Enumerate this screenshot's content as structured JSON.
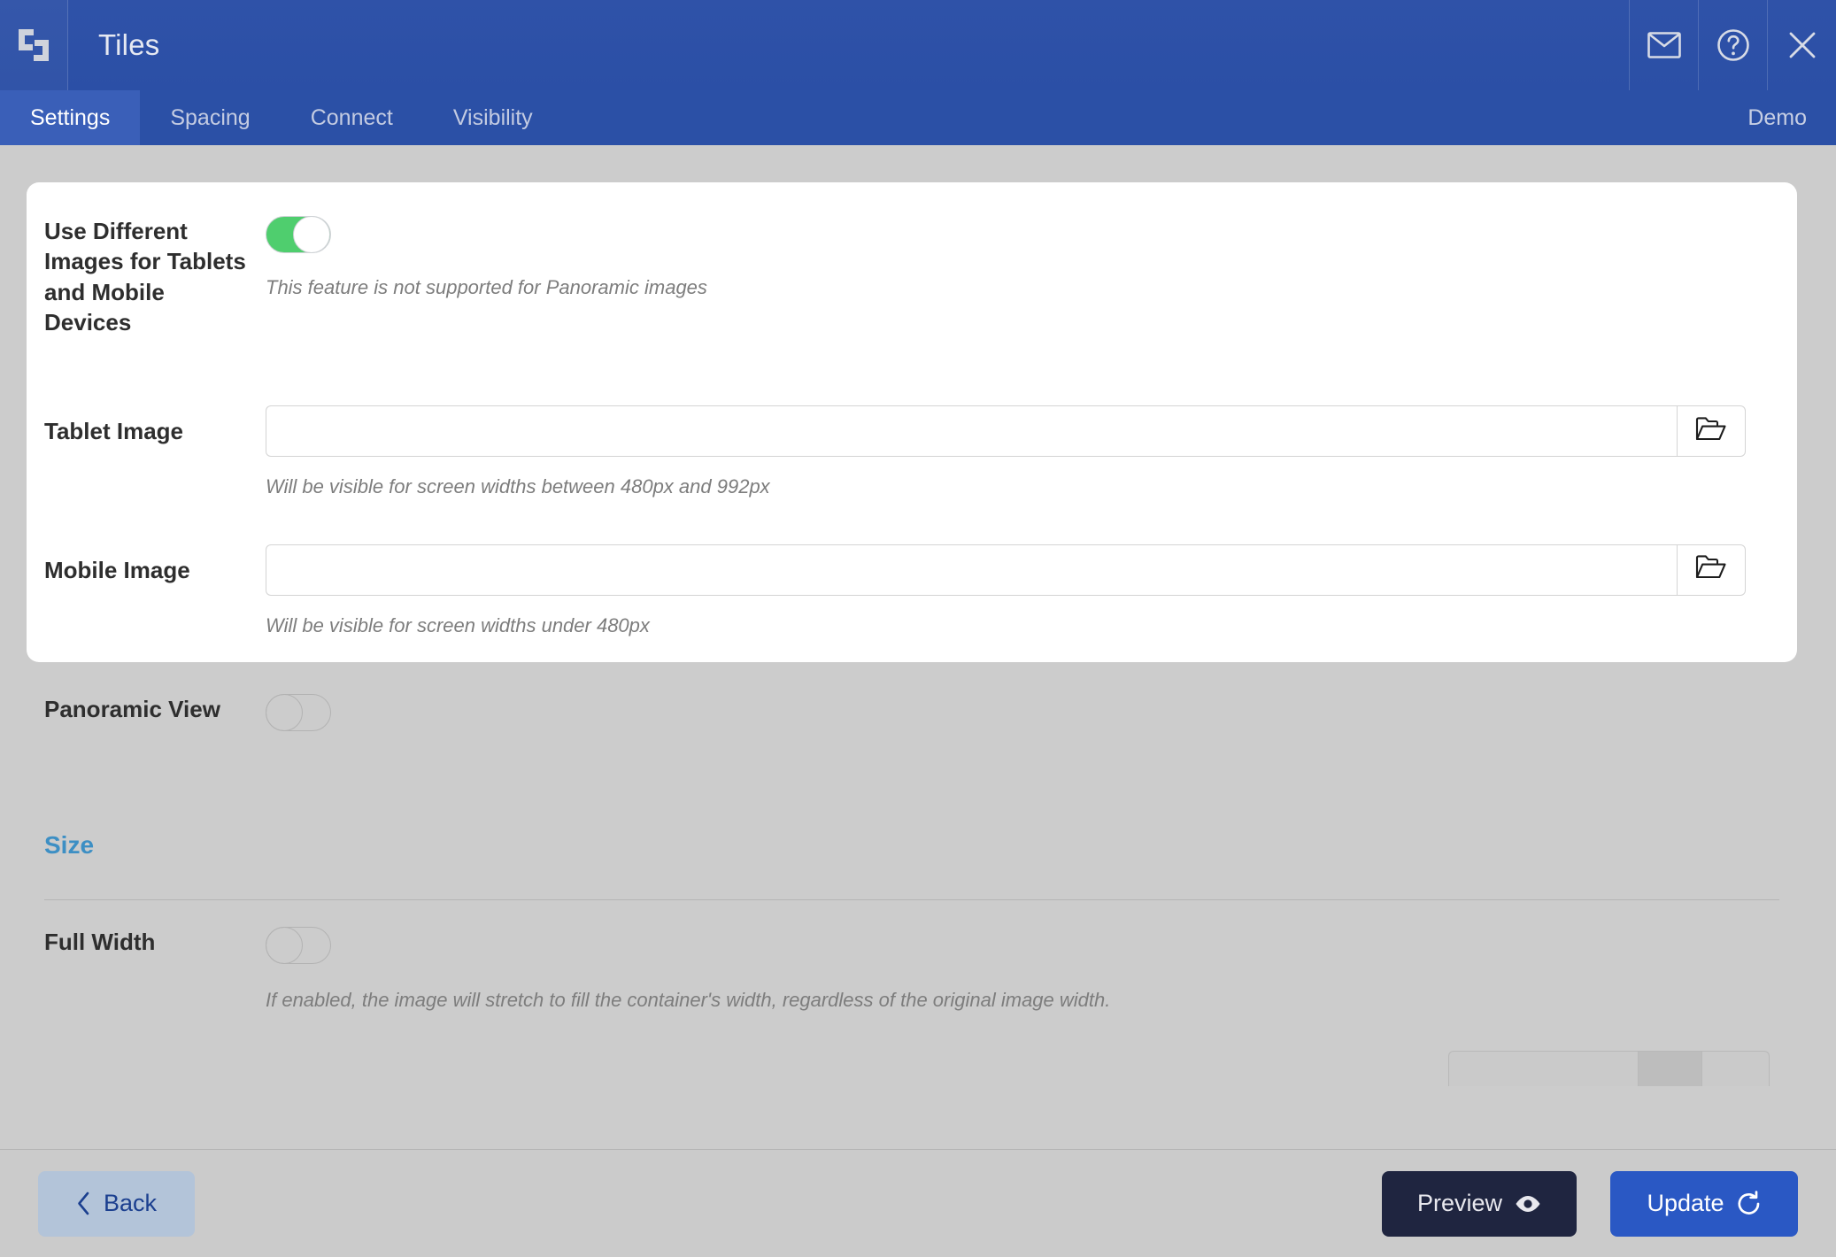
{
  "window": {
    "title": "Tiles",
    "logo_icon": "tiles-logo-icon",
    "actions": [
      {
        "name": "mail-icon",
        "label": "Mail"
      },
      {
        "name": "help-icon",
        "label": "Help"
      },
      {
        "name": "close-icon",
        "label": "Close"
      }
    ]
  },
  "tabs": {
    "items": [
      {
        "label": "Settings",
        "active": true
      },
      {
        "label": "Spacing",
        "active": false
      },
      {
        "label": "Connect",
        "active": false
      },
      {
        "label": "Visibility",
        "active": false
      }
    ],
    "right_label": "Demo"
  },
  "settings": {
    "different_images": {
      "label": "Use Different Images for Tablets and Mobile Devices",
      "toggle_state": "on",
      "helper": "This feature is not supported for Panoramic images"
    },
    "tablet_image": {
      "label": "Tablet Image",
      "value": "",
      "placeholder": "",
      "browse_icon": "open-folder-icon",
      "helper": "Will be visible for screen widths between 480px and 992px"
    },
    "mobile_image": {
      "label": "Mobile Image",
      "value": "",
      "placeholder": "",
      "browse_icon": "open-folder-icon",
      "helper": "Will be visible for screen widths under 480px"
    },
    "panoramic_view": {
      "label": "Panoramic View",
      "toggle_state": "off"
    },
    "size_section": {
      "title": "Size"
    },
    "full_width": {
      "label": "Full Width",
      "toggle_state": "off",
      "helper": "If enabled, the image will stretch to fill the container's width, regardless of the original image width."
    }
  },
  "footer": {
    "back_label": "Back",
    "back_icon": "chevron-left-icon",
    "preview_label": "Preview",
    "preview_icon": "eye-icon",
    "update_label": "Update",
    "update_icon": "refresh-icon"
  },
  "colors": {
    "header_blue": "#2b50a6",
    "active_tab_blue": "#3a5fb8",
    "page_bg": "#cccccc",
    "card_bg": "#ffffff",
    "toggle_on_green": "#4fce6e",
    "section_heading_blue": "#3d8fc4",
    "update_blue": "#2a58c4",
    "preview_dark": "#1f2540",
    "back_bg": "#b3c4d9",
    "back_text": "#1b3f8f"
  }
}
